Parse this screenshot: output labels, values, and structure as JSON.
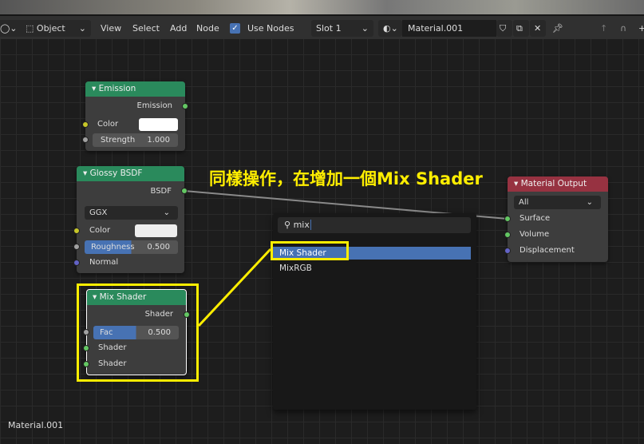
{
  "header": {
    "mode": "Object",
    "menus": [
      "View",
      "Select",
      "Add",
      "Node"
    ],
    "use_nodes_label": "Use Nodes",
    "use_nodes_checked": true,
    "slot": "Slot 1",
    "material": "Material.001"
  },
  "nodes": {
    "emission": {
      "title": "Emission",
      "output": "Emission",
      "color_label": "Color",
      "strength_label": "Strength",
      "strength": "1.000"
    },
    "glossy": {
      "title": "Glossy BSDF",
      "output": "BSDF",
      "distribution": "GGX",
      "color_label": "Color",
      "roughness_label": "Roughness",
      "roughness": "0.500",
      "normal_label": "Normal"
    },
    "mix": {
      "title": "Mix Shader",
      "output": "Shader",
      "fac_label": "Fac",
      "fac": "0.500",
      "shader1": "Shader",
      "shader2": "Shader"
    },
    "output": {
      "title": "Material Output",
      "target": "All",
      "surface": "Surface",
      "volume": "Volume",
      "displacement": "Displacement"
    }
  },
  "search": {
    "query": "mix",
    "results": [
      "Mix Shader",
      "MixRGB"
    ]
  },
  "annotation": "同樣操作，在增加一個Mix Shader",
  "footer_label": "Material.001",
  "colors": {
    "shader_socket": "#63c763",
    "color_socket": "#c7c729",
    "float_socket": "#a1a1a1",
    "vector_socket": "#6363c7",
    "highlight": "#ffee00",
    "selection": "#4772b3"
  }
}
